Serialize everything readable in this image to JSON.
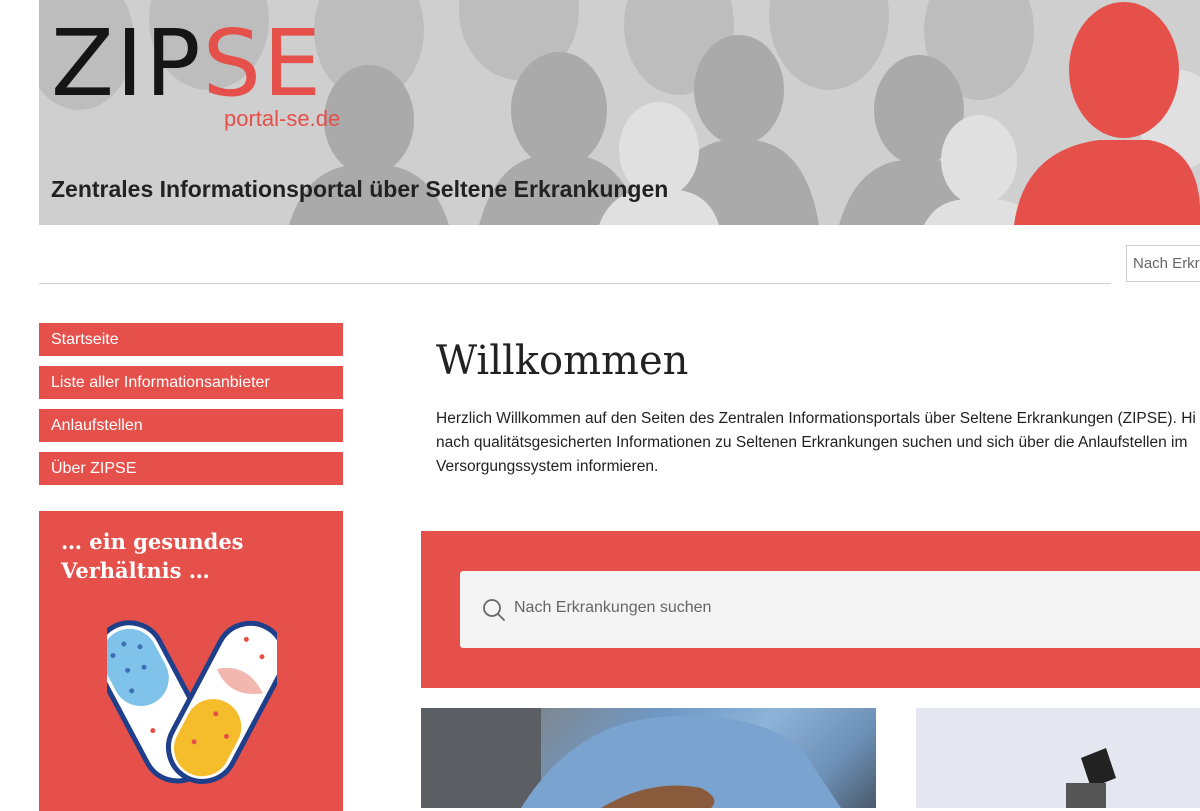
{
  "header": {
    "logo_zip": "ZIP",
    "logo_se": "SE",
    "logo_subtitle": "portal-se.de",
    "tagline": "Zentrales Informationsportal über Seltene Erkrankungen"
  },
  "top_search": {
    "placeholder": "Nach Erkrankungen suchen",
    "visible_text": "Nach Erkr"
  },
  "sidebar": {
    "items": [
      {
        "label": "Startseite"
      },
      {
        "label": "Liste aller Informationsanbieter"
      },
      {
        "label": "Anlaufstellen"
      },
      {
        "label": "Über ZIPSE"
      }
    ],
    "promo": {
      "line1": "… ein gesundes",
      "line2": "Verhältnis …"
    }
  },
  "main": {
    "title": "Willkommen",
    "intro_lines": [
      "Herzlich Willkommen auf den Seiten des Zentralen Informationsportals über Seltene Erkrankungen (ZIPSE). Hi",
      "nach qualitätsgesicherten Informationen zu Seltenen Erkrankungen suchen und sich über die Anlaufstellen im",
      "Versorgungssystem informieren."
    ],
    "search": {
      "placeholder": "Nach Erkrankungen suchen"
    }
  },
  "colors": {
    "accent": "#e5504b",
    "banner_gray": "#cfcfcf",
    "text": "#222222"
  },
  "icons": {
    "search": "search-icon",
    "promo": "plaster-v-icon"
  }
}
